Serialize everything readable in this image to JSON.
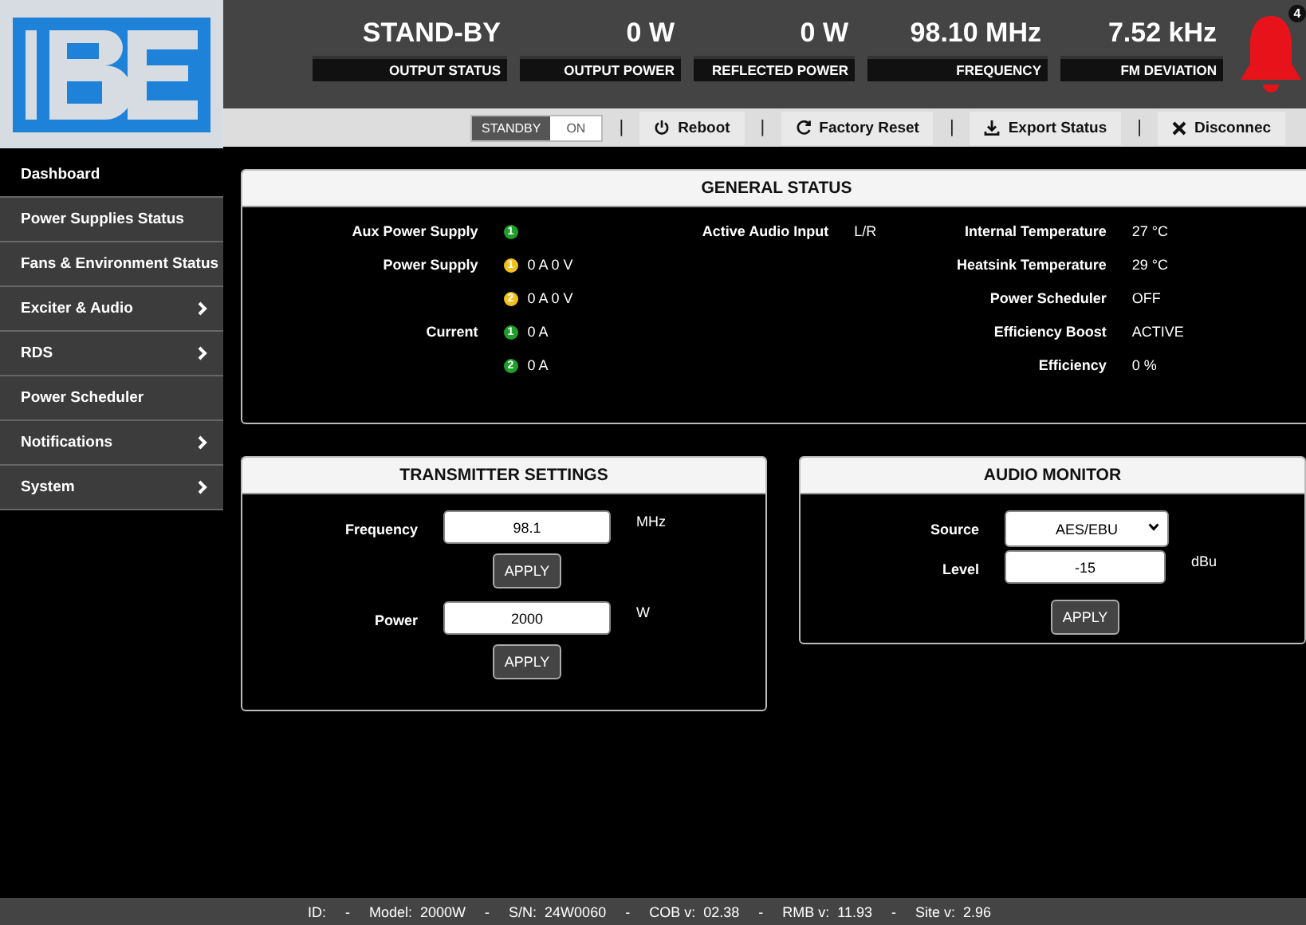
{
  "header": {
    "tiles": [
      {
        "value": "STAND-BY",
        "label": "OUTPUT STATUS"
      },
      {
        "value": "0 W",
        "label": "OUTPUT POWER"
      },
      {
        "value": "0 W",
        "label": "REFLECTED POWER"
      },
      {
        "value": "98.10 MHz",
        "label": "FREQUENCY"
      },
      {
        "value": "7.52 kHz",
        "label": "FM DEVIATION"
      }
    ],
    "alarm_badge": "4"
  },
  "toolbar": {
    "mode_toggle": [
      {
        "label": "STANDBY",
        "selected": true
      },
      {
        "label": "ON",
        "selected": false
      }
    ],
    "separator": "|",
    "buttons": [
      {
        "label": "Reboot"
      },
      {
        "label": "Factory Reset"
      },
      {
        "label": "Export Status"
      },
      {
        "label": "Disconnec"
      }
    ]
  },
  "sidebar": {
    "items": [
      {
        "label": "Dashboard",
        "selected": true,
        "submenu": false
      },
      {
        "label": "Power Supplies Status",
        "selected": false,
        "submenu": false
      },
      {
        "label": "Fans & Environment Status",
        "selected": false,
        "submenu": false
      },
      {
        "label": "Exciter & Audio",
        "selected": false,
        "submenu": true
      },
      {
        "label": "RDS",
        "selected": false,
        "submenu": true
      },
      {
        "label": "Power Scheduler",
        "selected": false,
        "submenu": false
      },
      {
        "label": "Notifications",
        "selected": false,
        "submenu": true
      },
      {
        "label": "System",
        "selected": false,
        "submenu": true
      }
    ]
  },
  "general_status": {
    "title": "GENERAL STATUS",
    "left": [
      {
        "label": "Aux Power Supply",
        "indicator": "1",
        "color": "#1e9e2a"
      },
      {
        "label": "Power Supply",
        "indicator": "1",
        "color": "#f2c11c",
        "reading": "0 A  0 V"
      },
      {
        "indicator": "2",
        "color": "#f2c11c",
        "reading": "0 A  0 V"
      },
      {
        "label": "Current",
        "indicator": "1",
        "color": "#1e9e2a",
        "reading": "0 A"
      },
      {
        "indicator": "2",
        "color": "#1e9e2a",
        "reading": "0 A"
      }
    ],
    "middle": [
      {
        "label": "Active Audio Input",
        "value": "L/R"
      }
    ],
    "right": [
      {
        "label": "Internal Temperature",
        "value": "27 °C"
      },
      {
        "label": "Heatsink Temperature",
        "value": "29 °C"
      },
      {
        "label": "Power Scheduler",
        "value": "OFF"
      },
      {
        "label": "Efficiency Boost",
        "value": "ACTIVE"
      },
      {
        "label": "Efficiency",
        "value": "0 %"
      }
    ]
  },
  "transmitter_settings": {
    "title": "TRANSMITTER SETTINGS",
    "fields": [
      {
        "label": "Frequency",
        "value": "98.1",
        "unit": "MHz",
        "button": "APPLY"
      },
      {
        "label": "Power",
        "value": "2000",
        "unit": "W",
        "button": "APPLY"
      }
    ]
  },
  "audio_monitor": {
    "title": "AUDIO MONITOR",
    "source": {
      "label": "Source",
      "value": "AES/EBU"
    },
    "level": {
      "label": "Level",
      "value": "-15",
      "unit": "dBu"
    },
    "button": "APPLY"
  },
  "footer": {
    "separator": "-",
    "items": [
      "ID:",
      "Model:  2000W",
      "S/N:  24W0060",
      "COB v:  02.38",
      "RMB v:  11.93",
      "Site v:  2.96"
    ]
  }
}
